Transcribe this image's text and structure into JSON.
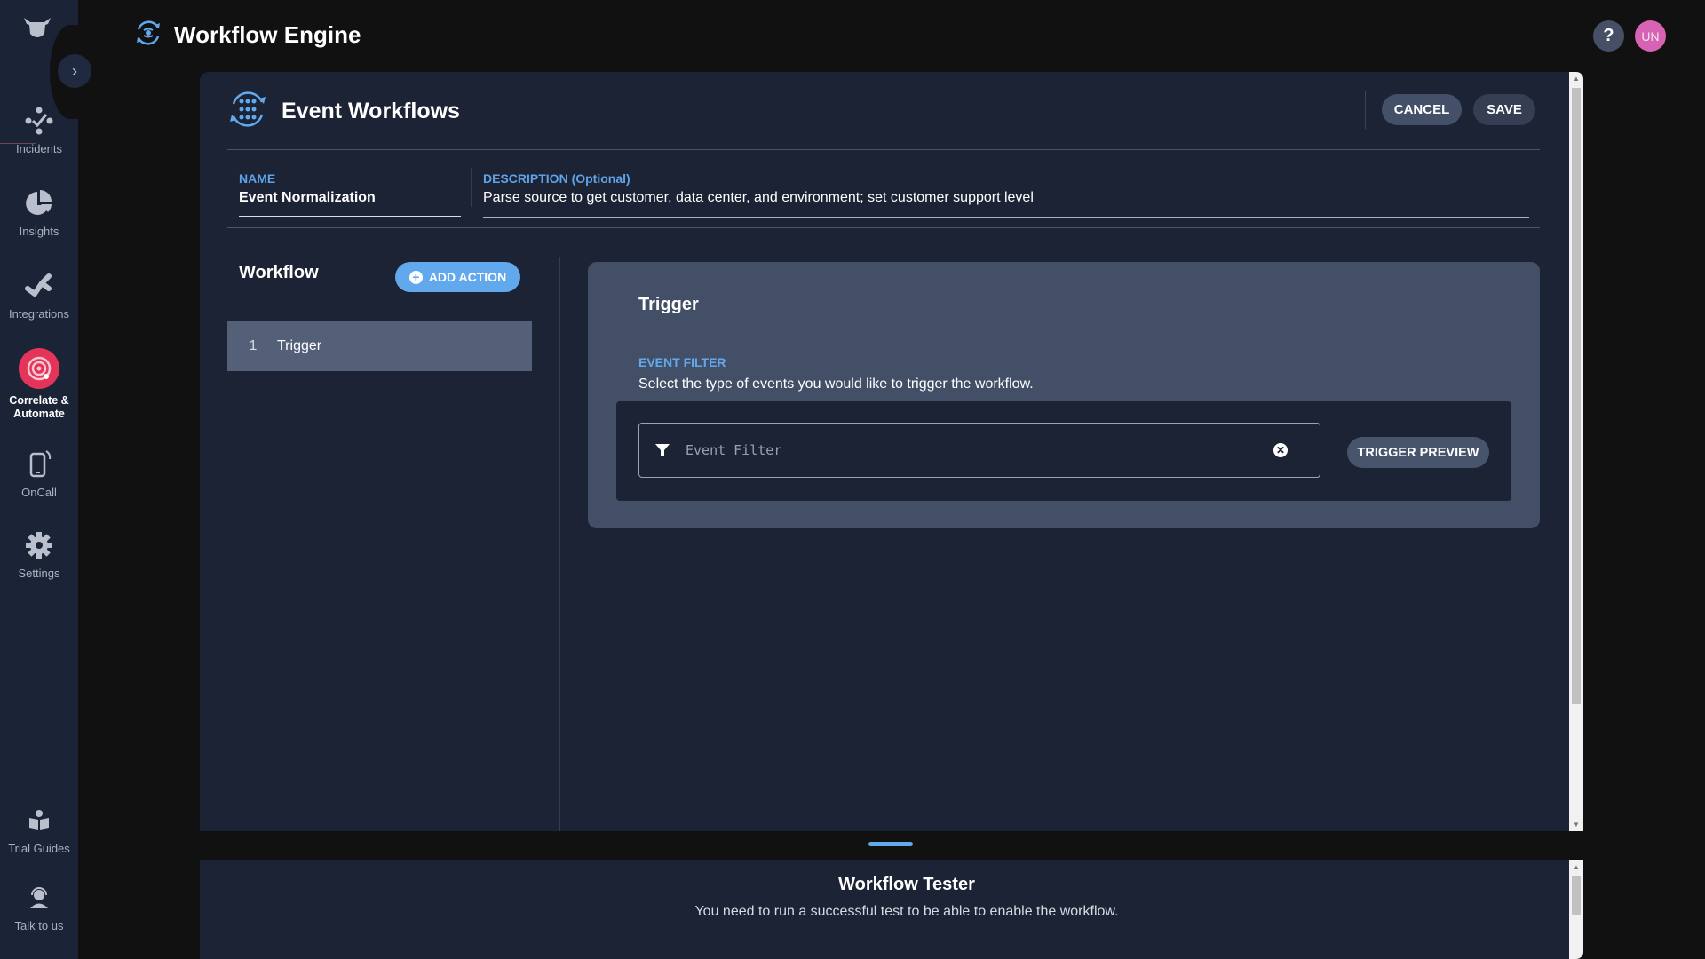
{
  "app": {
    "title": "Workflow Engine",
    "title_icon": "workflow-engine-icon",
    "logo_icon": "bull-logo-icon",
    "expand_icon": "chevron-right-icon"
  },
  "sidebar": {
    "items": [
      {
        "label": "Incidents",
        "icon": "incidents-icon",
        "active": false
      },
      {
        "label": "Insights",
        "icon": "pie-chart-icon",
        "active": false
      },
      {
        "label": "Integrations",
        "icon": "integrations-icon",
        "active": false
      },
      {
        "label": "Correlate & Automate",
        "icon": "radar-target-icon",
        "active": true
      },
      {
        "label": "OnCall",
        "icon": "mobile-phone-icon",
        "active": false
      },
      {
        "label": "Settings",
        "icon": "gear-icon",
        "active": false
      }
    ],
    "bottom_items": [
      {
        "label": "Trial Guides",
        "icon": "reading-book-icon"
      },
      {
        "label": "Talk to us",
        "icon": "headset-support-icon"
      }
    ]
  },
  "topbar": {
    "help_label": "?",
    "avatar_initials": "UN",
    "avatar_color": "#d663b4"
  },
  "panel": {
    "title": "Event Workflows",
    "cancel_label": "CANCEL",
    "save_label": "SAVE",
    "name_label": "NAME",
    "name_value": "Event Normalization",
    "description_label": "DESCRIPTION (Optional)",
    "description_value": "Parse source to get customer, data center, and environment; set customer support level"
  },
  "workflow": {
    "title": "Workflow",
    "add_action_label": "ADD ACTION",
    "steps": [
      {
        "number": "1",
        "name": "Trigger"
      }
    ]
  },
  "trigger": {
    "title": "Trigger",
    "event_filter_label": "EVENT FILTER",
    "event_filter_description": "Select the type of events you would like to trigger the workflow.",
    "filter_placeholder": "Event Filter",
    "trigger_preview_label": "TRIGGER PREVIEW"
  },
  "tester": {
    "title": "Workflow Tester",
    "description": "You need to run a successful test to be able to enable the workflow."
  },
  "colors": {
    "accent": "#62a8ec",
    "active_nav": "#e5345a",
    "sidebar_bg": "#1b2336",
    "panel_bg": "#1c2335",
    "card_bg": "#434f66"
  }
}
